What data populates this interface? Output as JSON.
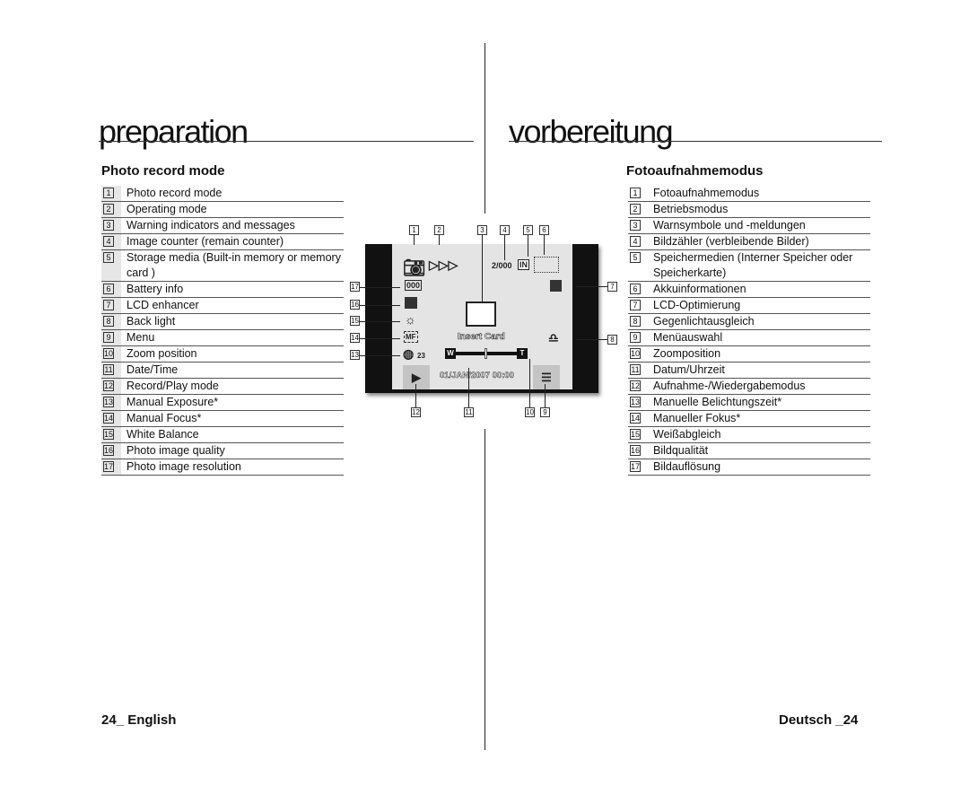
{
  "left": {
    "title": "preparation",
    "subtitle": "Photo record mode",
    "footer": "24_ English",
    "items": [
      "Photo record mode",
      "Operating mode",
      "Warning indicators and messages",
      "Image counter (remain counter)",
      "Storage media (Built-in memory or memory card )",
      "Battery info",
      "LCD enhancer",
      "Back light",
      "Menu",
      "Zoom position",
      "Date/Time",
      "Record/Play mode",
      "Manual Exposure*",
      "Manual Focus*",
      "White Balance",
      "Photo image quality",
      "Photo image resolution"
    ]
  },
  "right": {
    "title": "vorbereitung",
    "subtitle": "Fotoaufnahmemodus",
    "footer": "Deutsch _24",
    "items": [
      "Fotoaufnahmemodus",
      "Betriebsmodus",
      "Warnsymbole und -meldungen",
      "Bildzähler (verbleibende Bilder)",
      "Speichermedien (Interner Speicher oder Speicherkarte)",
      "Akkuinformationen",
      "LCD-Optimierung",
      "Gegenlichtausgleich",
      "Menüauswahl",
      "Zoomposition",
      "Datum/Uhrzeit",
      "Aufnahme-/Wiedergabemodus",
      "Manuelle Belichtungszeit*",
      "Manueller Fokus*",
      "Weißabgleich",
      "Bildqualität",
      "Bildauflösung"
    ]
  },
  "screen": {
    "counter": "2/000",
    "storage": "IN",
    "message": "Insert Card",
    "datetime": "01/JAN/2007 00:00",
    "zoom_w": "W",
    "zoom_t": "T",
    "exposure": "23",
    "focus": "MF",
    "mode_arrows": "▷▷▷"
  },
  "nums": [
    "1",
    "2",
    "3",
    "4",
    "5",
    "6",
    "7",
    "8",
    "9",
    "10",
    "11",
    "12",
    "13",
    "14",
    "15",
    "16",
    "17"
  ]
}
